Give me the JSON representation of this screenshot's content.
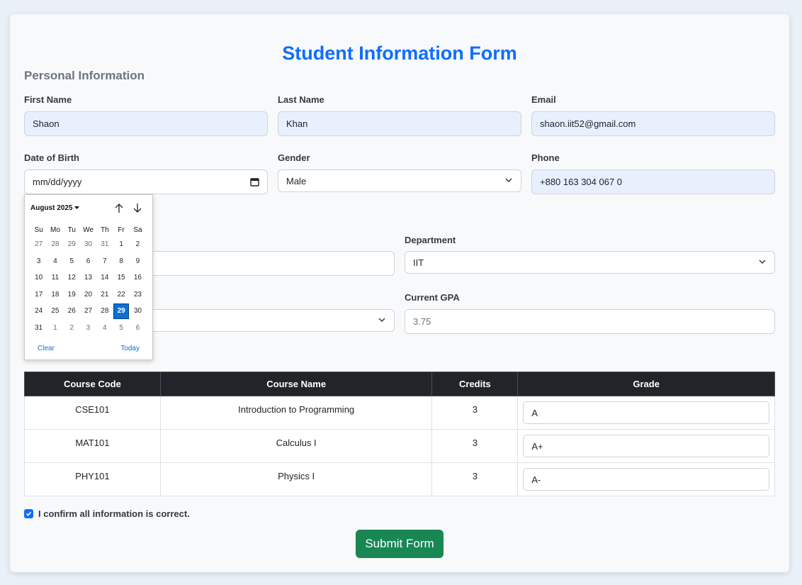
{
  "form": {
    "title": "Student Information Form",
    "section_personal": "Personal Information",
    "confirm_label": "I confirm all information is correct.",
    "submit_label": "Submit Form"
  },
  "fields": {
    "first_name": {
      "label": "First Name",
      "value": "Shaon"
    },
    "last_name": {
      "label": "Last Name",
      "value": "Khan"
    },
    "email": {
      "label": "Email",
      "value": "shaon.iit52@gmail.com"
    },
    "dob": {
      "label": "Date of Birth",
      "placeholder": "mm/dd/yyyy"
    },
    "gender": {
      "label": "Gender",
      "value": "Male"
    },
    "phone": {
      "label": "Phone",
      "value": "+880 163 304 067 0"
    },
    "department": {
      "label": "Department",
      "value": "IIT"
    },
    "gpa": {
      "label": "Current GPA",
      "value": "3.75"
    }
  },
  "datepicker": {
    "month_label": "August 2025",
    "weekdays": [
      "Su",
      "Mo",
      "Tu",
      "We",
      "Th",
      "Fr",
      "Sa"
    ],
    "weeks": [
      [
        "27",
        "28",
        "29",
        "30",
        "31",
        "1",
        "2"
      ],
      [
        "3",
        "4",
        "5",
        "6",
        "7",
        "8",
        "9"
      ],
      [
        "10",
        "11",
        "12",
        "13",
        "14",
        "15",
        "16"
      ],
      [
        "17",
        "18",
        "19",
        "20",
        "21",
        "22",
        "23"
      ],
      [
        "24",
        "25",
        "26",
        "27",
        "28",
        "29",
        "30"
      ],
      [
        "31",
        "1",
        "2",
        "3",
        "4",
        "5",
        "6"
      ]
    ],
    "selected_day": "29",
    "clear_label": "Clear",
    "today_label": "Today"
  },
  "courses": {
    "headers": [
      "Course Code",
      "Course Name",
      "Credits",
      "Grade"
    ],
    "rows": [
      {
        "code": "CSE101",
        "name": "Introduction to Programming",
        "credits": "3",
        "grade": "A"
      },
      {
        "code": "MAT101",
        "name": "Calculus I",
        "credits": "3",
        "grade": "A+"
      },
      {
        "code": "PHY101",
        "name": "Physics I",
        "credits": "3",
        "grade": "A-"
      }
    ]
  },
  "colors": {
    "accent": "#0d6efd",
    "submit": "#198754",
    "table_header": "#212529"
  }
}
